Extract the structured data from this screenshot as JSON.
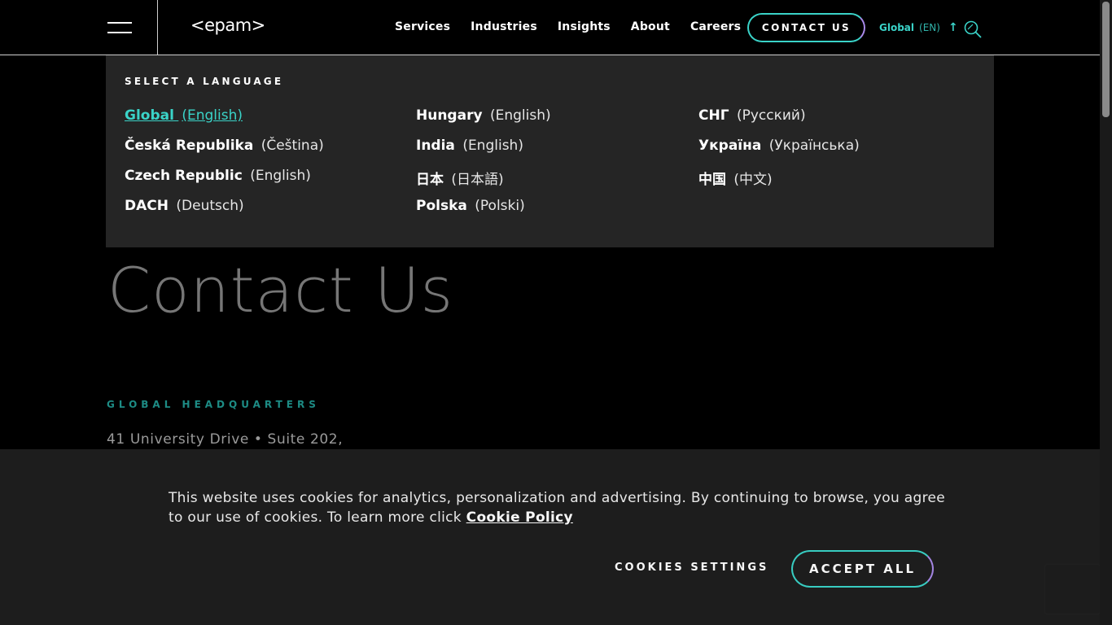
{
  "header": {
    "logo": "<epam>",
    "nav": [
      "Services",
      "Industries",
      "Insights",
      "About",
      "Careers"
    ],
    "contact_label": "CONTACT US",
    "lang_region": "Global",
    "lang_code": "(EN)",
    "accent": "#3ad3c8",
    "accent2": "#a889e8"
  },
  "language_panel": {
    "title": "SELECT A LANGUAGE",
    "columns": [
      [
        {
          "country": "Global",
          "language": "(English)",
          "active": true
        },
        {
          "country": "Česká Republika",
          "language": "(Čeština)"
        },
        {
          "country": "Czech Republic",
          "language": "(English)"
        },
        {
          "country": "DACH",
          "language": "(Deutsch)"
        }
      ],
      [
        {
          "country": "Hungary",
          "language": "(English)"
        },
        {
          "country": "India",
          "language": "(English)"
        },
        {
          "country": "日本",
          "language": "(日本語)"
        },
        {
          "country": "Polska",
          "language": "(Polski)"
        }
      ],
      [
        {
          "country": "СНГ",
          "language": "(Русский)"
        },
        {
          "country": "Україна",
          "language": "(Українська)"
        },
        {
          "country": "中国",
          "language": "(中文)"
        }
      ]
    ]
  },
  "main": {
    "title": "Contact Us",
    "hq_label": "GLOBAL HEADQUARTERS",
    "hq_address": "41 University Drive • Suite 202,"
  },
  "cookie_banner": {
    "text": "This website uses cookies for analytics, personalization and advertising. By continuing to browse, you agree to our use of cookies. To learn more click ",
    "link_label": "Cookie Policy",
    "settings_label": "COOKIES SETTINGS",
    "accept_label": "ACCEPT ALL"
  }
}
